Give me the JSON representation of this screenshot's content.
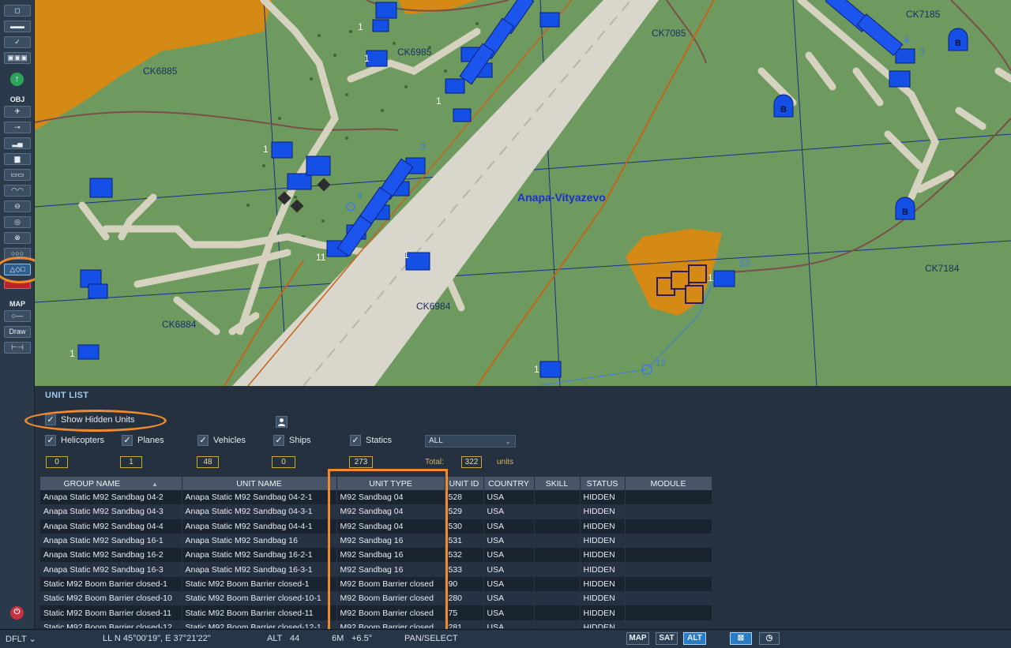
{
  "toolbar": {
    "obj_label": "OBJ",
    "map_label": "MAP",
    "draw_label": "Draw"
  },
  "map": {
    "airport_label": "Anapa-Vityazevo",
    "grid_labels": [
      "CK6885",
      "CK6985",
      "CK7085",
      "CK7185",
      "CK6884",
      "CK6984",
      "CK7184"
    ]
  },
  "panel": {
    "title": "UNIT LIST",
    "show_hidden_label": "Show Hidden Units",
    "filters": [
      {
        "label": "Helicopters",
        "count": "0"
      },
      {
        "label": "Planes",
        "count": "1"
      },
      {
        "label": "Vehicles",
        "count": "48"
      },
      {
        "label": "Ships",
        "count": "0"
      },
      {
        "label": "Statics",
        "count": "273"
      }
    ],
    "coalition_select": "ALL",
    "total_label": "Total:",
    "total_value": "322",
    "total_units": "units"
  },
  "table": {
    "columns": [
      "GROUP NAME",
      "UNIT NAME",
      "UNIT TYPE",
      "UNIT ID",
      "COUNTRY",
      "SKILL",
      "STATUS",
      "MODULE"
    ],
    "rows": [
      [
        "Anapa Static M92 Sandbag 04-2",
        "Anapa Static M92 Sandbag 04-2-1",
        "M92 Sandbag 04",
        "528",
        "USA",
        "",
        "HIDDEN",
        ""
      ],
      [
        "Anapa Static M92 Sandbag 04-3",
        "Anapa Static M92 Sandbag 04-3-1",
        "M92 Sandbag 04",
        "529",
        "USA",
        "",
        "HIDDEN",
        ""
      ],
      [
        "Anapa Static M92 Sandbag 04-4",
        "Anapa Static M92 Sandbag 04-4-1",
        "M92 Sandbag 04",
        "530",
        "USA",
        "",
        "HIDDEN",
        ""
      ],
      [
        "Anapa Static M92 Sandbag 16-1",
        "Anapa Static M92 Sandbag 16",
        "M92 Sandbag 16",
        "531",
        "USA",
        "",
        "HIDDEN",
        ""
      ],
      [
        "Anapa Static M92 Sandbag 16-2",
        "Anapa Static M92 Sandbag 16-2-1",
        "M92 Sandbag 16",
        "532",
        "USA",
        "",
        "HIDDEN",
        ""
      ],
      [
        "Anapa Static M92 Sandbag 16-3",
        "Anapa Static M92 Sandbag 16-3-1",
        "M92 Sandbag 16",
        "533",
        "USA",
        "",
        "HIDDEN",
        ""
      ],
      [
        "Static M92 Boom Barrier closed-1",
        "Static M92 Boom Barrier closed-1",
        "M92 Boom Barrier closed",
        "90",
        "USA",
        "",
        "HIDDEN",
        ""
      ],
      [
        "Static M92 Boom Barrier closed-10",
        "Static M92 Boom Barrier closed-10-1",
        "M92 Boom Barrier closed",
        "280",
        "USA",
        "",
        "HIDDEN",
        ""
      ],
      [
        "Static M92 Boom Barrier closed-11",
        "Static M92 Boom Barrier closed-11",
        "M92 Boom Barrier closed",
        "75",
        "USA",
        "",
        "HIDDEN",
        ""
      ],
      [
        "Static M92 Boom Barrier closed-12",
        "Static M92 Boom Barrier closed-12-1",
        "M92 Boom Barrier closed",
        "281",
        "USA",
        "",
        "HIDDEN",
        ""
      ]
    ]
  },
  "statusbar": {
    "profile": "DFLT",
    "coords": "LL  N 45°00'19\", E 37°21'22\"",
    "alt_label": "ALT",
    "alt_value": "44",
    "scale": "6M",
    "temp": "+6.5°",
    "mode": "PAN/SELECT",
    "map_btn": "MAP",
    "sat_btn": "SAT",
    "alt_btn": "ALT"
  },
  "colors": {
    "highlight": "#f08a2c",
    "blue_units": "#1450e6",
    "terrain": "#6f9a5f",
    "orange_zone": "#d48a14"
  }
}
